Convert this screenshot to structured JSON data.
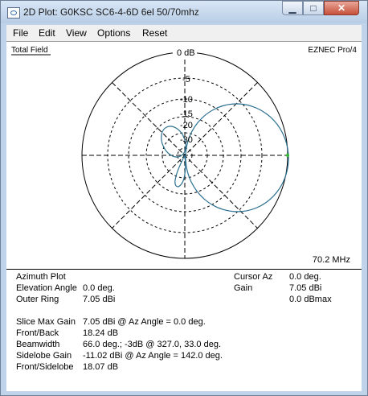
{
  "window": {
    "title": "2D Plot: G0KSC SC6-4-6D 6el 50/70mhz"
  },
  "controls": {
    "minimize": "▁",
    "maximize": "□",
    "close": "✕"
  },
  "menu": [
    "File",
    "Edit",
    "View",
    "Options",
    "Reset"
  ],
  "plot": {
    "top_left_label": "Total Field",
    "top_right_label": "EZNEC Pro/4",
    "bottom_right_label": "70.2 MHz",
    "ring_labels": [
      "0 dB",
      "-5",
      "-10",
      "-15",
      "-20",
      "-30"
    ],
    "trace_color": "#2a6f8f"
  },
  "info": {
    "plot_type": "Azimuth Plot",
    "elevation_angle_label": "Elevation Angle",
    "elevation_angle_value": "0.0 deg.",
    "outer_ring_label": "Outer Ring",
    "outer_ring_value": "7.05 dBi",
    "cursor_az_label": "Cursor Az",
    "cursor_az_value": "0.0 deg.",
    "gain_label": "Gain",
    "gain_value": "7.05 dBi",
    "dbmax_value": "0.0 dBmax",
    "slice_max_gain_label": "Slice Max Gain",
    "slice_max_gain_value": "7.05 dBi @ Az Angle = 0.0 deg.",
    "front_back_label": "Front/Back",
    "front_back_value": "18.24 dB",
    "beamwidth_label": "Beamwidth",
    "beamwidth_value": "66.0 deg.; -3dB @ 327.0, 33.0 deg.",
    "sidelobe_gain_label": "Sidelobe Gain",
    "sidelobe_gain_value": "-11.02 dBi @ Az Angle = 142.0 deg.",
    "front_sidelobe_label": "Front/Sidelobe",
    "front_sidelobe_value": "18.07 dB"
  }
}
